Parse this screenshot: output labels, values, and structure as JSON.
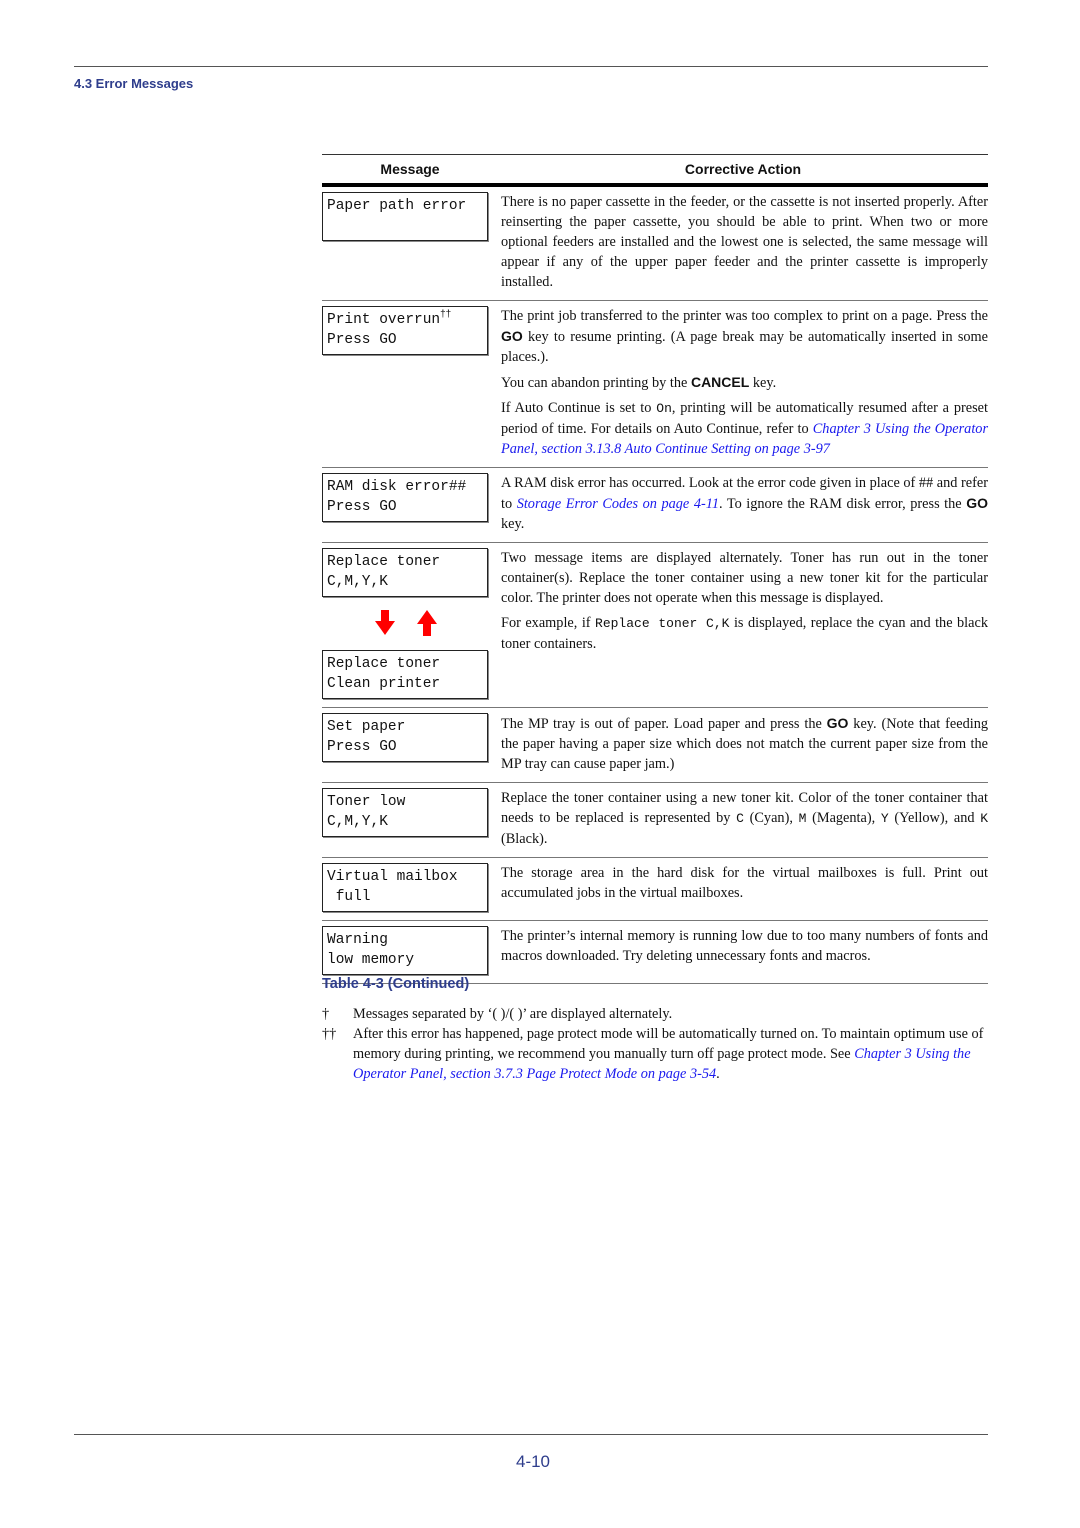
{
  "header": {
    "section": "4.3 Error Messages"
  },
  "table": {
    "columns": {
      "message": "Message",
      "action": "Corrective Action"
    },
    "rows": [
      {
        "lcd": [
          "Paper path error",
          ""
        ],
        "action": [
          [
            {
              "t": "There is no paper cassette in the feeder, or the cassette is not inserted properly. After reinserting the paper cassette, you should be able to print. When two or more optional feeders are installed and the lowest one is selected, the same message will appear if any of the upper paper feeder and the printer cassette is improperly installed."
            }
          ]
        ]
      },
      {
        "lcd": [
          "Print overrun",
          "Press GO"
        ],
        "lcd_sup": "††",
        "action": [
          [
            {
              "t": "The print job transferred to the printer was too complex to print on a page. Press the "
            },
            {
              "k": "GO"
            },
            {
              "t": " key to resume printing. (A page break may be automatically inserted in some places.)."
            }
          ],
          [
            {
              "t": "You can abandon printing by the "
            },
            {
              "k": "CANCEL"
            },
            {
              "t": " key."
            }
          ],
          [
            {
              "t": "If Auto Continue is set to "
            },
            {
              "m": "On"
            },
            {
              "t": ", printing will be automatically resumed after a preset period of time. For details on Auto Continue, refer to "
            },
            {
              "l": "Chapter 3 Using the Operator Panel, section 3.13.8 Auto Continue Setting on page 3-97"
            }
          ]
        ]
      },
      {
        "lcd": [
          "RAM disk error##",
          "Press GO"
        ],
        "action": [
          [
            {
              "t": "A RAM disk error has occurred. Look at the error code given in place of ## and refer to "
            },
            {
              "l": "Storage Error Codes on page 4-11"
            },
            {
              "t": ". To ignore the RAM disk error, press the "
            },
            {
              "k": "GO"
            },
            {
              "t": " key."
            }
          ]
        ]
      },
      {
        "lcd": [
          "Replace toner",
          "C,M,Y,K"
        ],
        "lcd2": [
          "Replace toner",
          "Clean printer"
        ],
        "arrows": [
          "arrow-down-icon",
          "arrow-up-icon"
        ],
        "arrow_color": "#ff0000",
        "action": [
          [
            {
              "t": "Two message items are displayed alternately. Toner has run out in the toner container(s). Replace the toner container using a new toner kit for the particular color. The printer does not operate when this message is displayed."
            }
          ],
          [
            {
              "t": "For example, if "
            },
            {
              "m": "Replace toner C,K"
            },
            {
              "t": " is displayed, replace the cyan and the black toner containers."
            }
          ]
        ]
      },
      {
        "lcd": [
          "Set paper",
          "Press GO"
        ],
        "action": [
          [
            {
              "t": "The MP tray is out of paper. Load paper and press the "
            },
            {
              "k": "GO"
            },
            {
              "t": " key. (Note that feeding the paper having a paper size which does not match the current paper size from the MP tray can cause paper jam.)"
            }
          ]
        ]
      },
      {
        "lcd": [
          "Toner low",
          "C,M,Y,K"
        ],
        "action": [
          [
            {
              "t": "Replace the toner container using a new toner kit. Color of the toner container that needs to be replaced is represented by "
            },
            {
              "m": "C"
            },
            {
              "t": " (Cyan), "
            },
            {
              "m": "M"
            },
            {
              "t": " (Magenta), "
            },
            {
              "m": "Y"
            },
            {
              "t": " (Yellow), and "
            },
            {
              "m": "K"
            },
            {
              "t": " (Black)."
            }
          ]
        ]
      },
      {
        "lcd": [
          "Virtual mailbox",
          " full"
        ],
        "action": [
          [
            {
              "t": "The storage area in the hard disk for the virtual mailboxes is full. Print out accumulated jobs in the virtual mailboxes."
            }
          ]
        ]
      },
      {
        "lcd": [
          "Warning",
          "low memory"
        ],
        "action": [
          [
            {
              "t": "The printer’s internal memory is running low due to too many numbers of fonts and macros downloaded. Try deleting unnecessary fonts and macros."
            }
          ]
        ]
      }
    ]
  },
  "caption": "Table 4-3  (Continued)",
  "notes": [
    {
      "mark": "†",
      "parts": [
        {
          "t": "Messages separated by ‘( )/( )’ are displayed alternately."
        }
      ]
    },
    {
      "mark": "††",
      "parts": [
        {
          "t": "After this error has happened, page protect mode will be automatically turned on. To maintain optimum use of memory during printing, we recommend you manually turn off page protect mode. See "
        },
        {
          "l": "Chapter 3 Using the Operator Panel, section 3.7.3 Page Protect Mode on page 3-54"
        },
        {
          "t": "."
        }
      ]
    }
  ],
  "footer": {
    "page_number": "4-10"
  },
  "colors": {
    "heading": "#2e3d8c",
    "link": "#1a1aee",
    "arrow": "#ff0000"
  }
}
